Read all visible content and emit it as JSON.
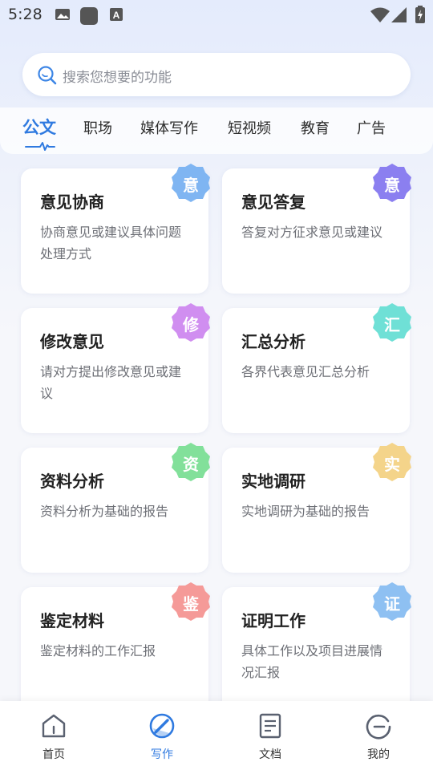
{
  "status": {
    "time": "5:28"
  },
  "search": {
    "placeholder": "搜索您想要的功能"
  },
  "tabs": [
    "公文",
    "职场",
    "媒体写作",
    "短视频",
    "教育",
    "广告"
  ],
  "cards": [
    {
      "title": "意见协商",
      "desc": "协商意见或建议具体问题处理方式",
      "badge": "意",
      "color": "#7fb5f2"
    },
    {
      "title": "意见答复",
      "desc": "答复对方征求意见或建议",
      "badge": "意",
      "color": "#8b7ff0"
    },
    {
      "title": "修改意见",
      "desc": "请对方提出修改意见或建议",
      "badge": "修",
      "color": "#d08ef0"
    },
    {
      "title": "汇总分析",
      "desc": "各界代表意见汇总分析",
      "badge": "汇",
      "color": "#6fe0d6"
    },
    {
      "title": "资料分析",
      "desc": "资料分析为基础的报告",
      "badge": "资",
      "color": "#82e09a"
    },
    {
      "title": "实地调研",
      "desc": "实地调研为基础的报告",
      "badge": "实",
      "color": "#f4d48a"
    },
    {
      "title": "鉴定材料",
      "desc": "鉴定材料的工作汇报",
      "badge": "鉴",
      "color": "#f59a98"
    },
    {
      "title": "证明工作",
      "desc": "具体工作以及项目进展情况汇报",
      "badge": "证",
      "color": "#8ec0f2"
    }
  ],
  "nav": [
    {
      "label": "首页",
      "icon": "home-icon"
    },
    {
      "label": "写作",
      "icon": "write-icon"
    },
    {
      "label": "文档",
      "icon": "document-icon"
    },
    {
      "label": "我的",
      "icon": "profile-icon"
    }
  ],
  "colors": {
    "accent": "#2f7ae0"
  }
}
